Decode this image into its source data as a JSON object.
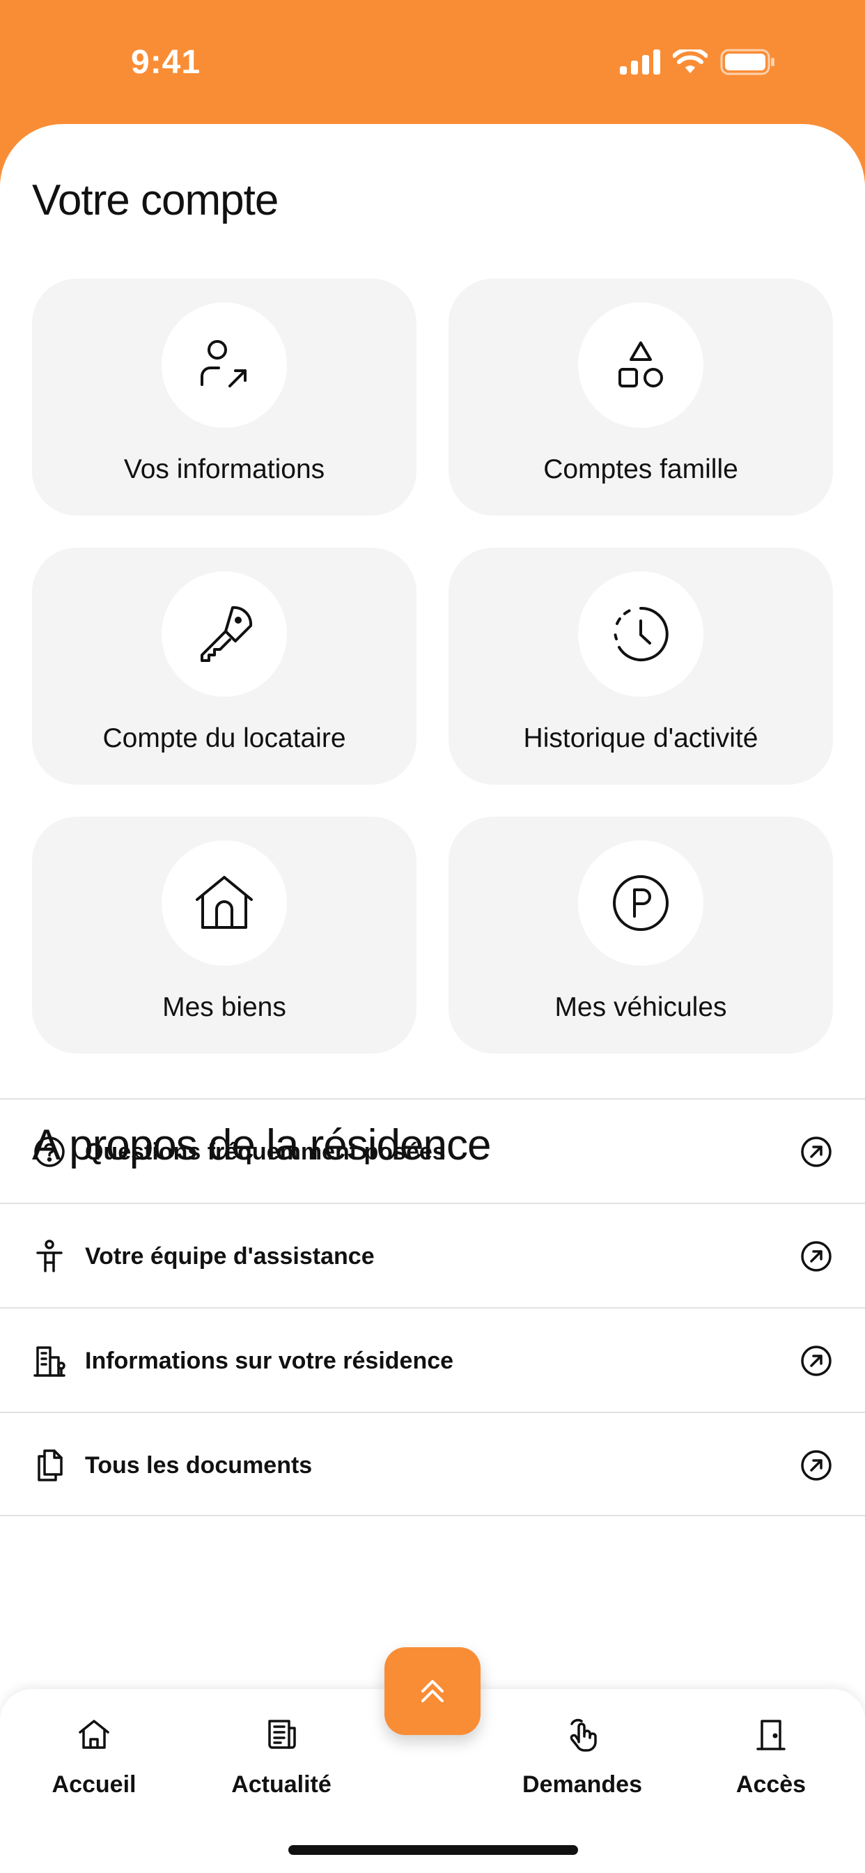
{
  "status_bar": {
    "time": "9:41"
  },
  "account": {
    "title": "Votre compte",
    "tiles": [
      {
        "label": "Vos informations",
        "icon": "user-arrow-icon"
      },
      {
        "label": "Comptes famille",
        "icon": "shapes-icon"
      },
      {
        "label": "Compte du locataire",
        "icon": "key-icon"
      },
      {
        "label": "Historique d'activité",
        "icon": "clock-history-icon"
      },
      {
        "label": "Mes biens",
        "icon": "house-icon"
      },
      {
        "label": "Mes véhicules",
        "icon": "parking-icon"
      }
    ]
  },
  "residence": {
    "title": "A propos de la résidence",
    "items": [
      {
        "label": "Questions fréquemment posées",
        "icon": "question-circle-icon"
      },
      {
        "label": "Votre équipe d'assistance",
        "icon": "person-icon"
      },
      {
        "label": "Informations sur votre résidence",
        "icon": "building-icon"
      },
      {
        "label": "Tous les documents",
        "icon": "documents-icon"
      }
    ]
  },
  "tabbar": {
    "tabs": [
      {
        "label": "Accueil",
        "icon": "home-icon"
      },
      {
        "label": "Actualité",
        "icon": "news-icon"
      },
      {
        "label": "Demandes",
        "icon": "hand-tap-icon"
      },
      {
        "label": "Accès",
        "icon": "door-icon"
      }
    ],
    "fab_icon": "double-chevron-up-icon"
  },
  "colors": {
    "accent": "#F98D36",
    "tile_bg": "#F4F4F4",
    "text": "#111111",
    "divider": "#E2E2E2"
  }
}
